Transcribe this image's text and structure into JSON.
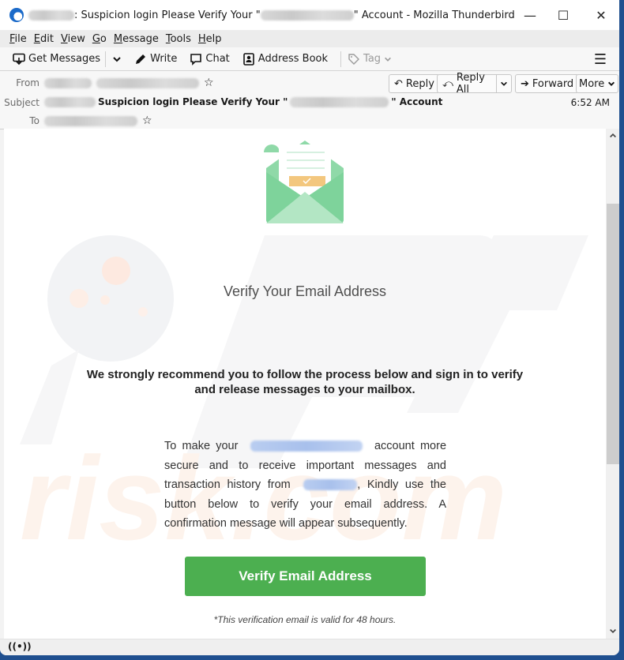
{
  "window": {
    "title_prefix": ": Suspicion login Please Verify Your \"",
    "title_suffix": "\" Account - Mozilla Thunderbird",
    "controls": {
      "minimize": "—",
      "maximize": "☐",
      "close": "✕"
    }
  },
  "menubar": {
    "items": [
      {
        "accel": "F",
        "rest": "ile"
      },
      {
        "accel": "E",
        "rest": "dit"
      },
      {
        "accel": "V",
        "rest": "iew"
      },
      {
        "accel": "G",
        "rest": "o"
      },
      {
        "accel": "M",
        "rest": "essage"
      },
      {
        "accel": "T",
        "rest": "ools"
      },
      {
        "accel": "H",
        "rest": "elp"
      }
    ]
  },
  "toolbar": {
    "get_messages": "Get Messages",
    "write": "Write",
    "chat": "Chat",
    "address_book": "Address Book",
    "tag": "Tag",
    "icons": {
      "get_messages": "⮋",
      "dropdown": "⌄",
      "write": "✎",
      "chat": "🗨",
      "address_book": "👤",
      "tag": "🏷",
      "menu": "☰"
    }
  },
  "header": {
    "from_label": "From",
    "subject_label": "Subject",
    "to_label": "To",
    "subject_text": "Suspicion login Please Verify Your \"",
    "subject_suffix": "\" Account",
    "time": "6:52 AM",
    "star": "☆",
    "actions": {
      "reply": "Reply",
      "reply_all": "Reply All",
      "forward": "Forward",
      "more": "More",
      "reply_icon": "↶",
      "reply_all_icon": "⤺",
      "forward_icon": "➔",
      "chevron": "⌄"
    }
  },
  "email": {
    "heading": "Verify Your Email Address",
    "lead": "We strongly recommend you to follow the process below and sign in to verify and release messages to your mailbox.",
    "para_1": "To make your",
    "para_2": "account more secure and to receive important messages and transaction history from",
    "para_3": ", Kindly use the button below to verify your email address. A confirmation message will appear subsequently.",
    "button": "Verify Email Address",
    "note": "*This verification email is valid for 48 hours.",
    "colors": {
      "button": "#4caf50",
      "envelope": "#8fd9a8",
      "check": "#f3c77e"
    }
  },
  "scrollbar": {
    "up": "⌃",
    "down": "⌄",
    "position_fraction": 0.2
  },
  "statusbar": {
    "icon": "((•))"
  }
}
